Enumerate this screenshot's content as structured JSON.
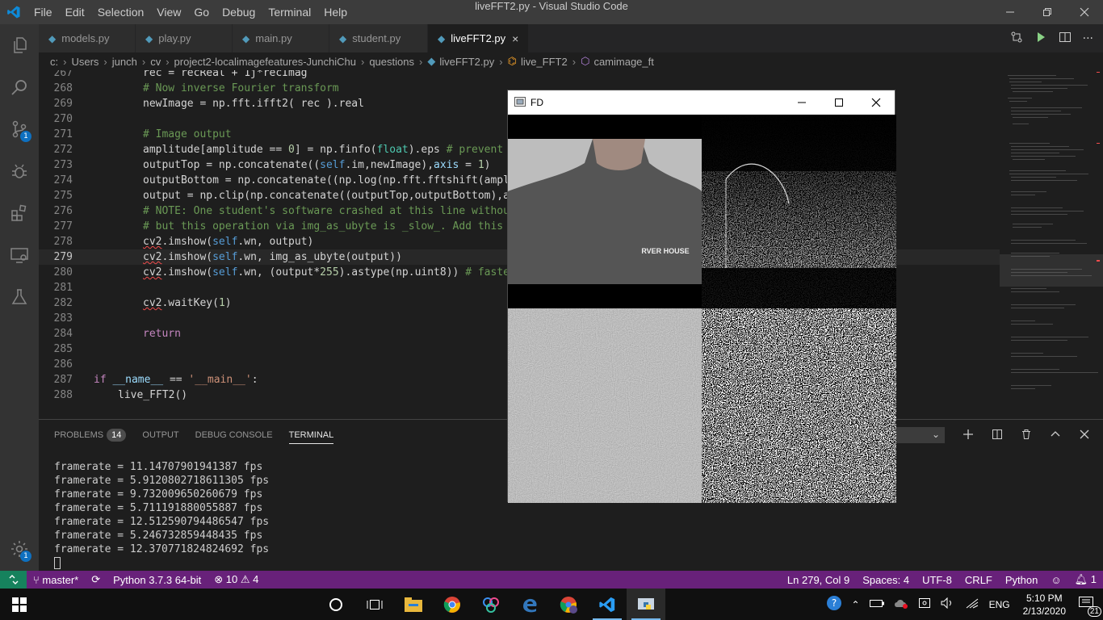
{
  "window": {
    "title": "liveFFT2.py - Visual Studio Code"
  },
  "menu": [
    "File",
    "Edit",
    "Selection",
    "View",
    "Go",
    "Debug",
    "Terminal",
    "Help"
  ],
  "activity_badges": {
    "source_control": "1",
    "settings": "1"
  },
  "tabs": [
    {
      "label": "models.py",
      "active": false
    },
    {
      "label": "play.py",
      "active": false
    },
    {
      "label": "main.py",
      "active": false
    },
    {
      "label": "student.py",
      "active": false
    },
    {
      "label": "liveFFT2.py",
      "active": true
    }
  ],
  "breadcrumb": [
    "c:",
    "Users",
    "junch",
    "cv",
    "project2-localimagefeatures-JunchiChu",
    "questions",
    "liveFFT2.py",
    "live_FFT2",
    "camimage_ft"
  ],
  "editor": {
    "line_numbers": [
      "267",
      "268",
      "269",
      "270",
      "271",
      "272",
      "273",
      "274",
      "275",
      "276",
      "277",
      "278",
      "279",
      "280",
      "281",
      "282",
      "283",
      "284",
      "285",
      "286",
      "287",
      "288"
    ],
    "code": {
      "l267a": "rec = recReal + 1j*recImag",
      "l268": "# Now inverse Fourier transform",
      "l269a": "newImage = np.fft.ifft2( rec ).real",
      "l271": "# Image output",
      "l272a": "amplitude[amplitude == ",
      "l272b": "0",
      "l272c": "] = np.finfo(",
      "l272d": "float",
      "l272e": ").eps ",
      "l272f": "# prevent a",
      "l273a": "outputTop = np.concatenate((",
      "l273b": "self",
      "l273c": ".im,newImage),",
      "l273d": "axis",
      "l273e": " = ",
      "l273f": "1",
      "l273g": ")",
      "l274a": "outputBottom = np.concatenate((np.log(np.fft.fftshift(ampli",
      "l275a": "output = np.clip(np.concatenate((outputTop,outputBottom),ax",
      "l276": "# NOTE: One student's software crashed at this line without",
      "l277": "# but this operation via img_as_ubyte is _slow_. Add this b",
      "l278a": "cv2",
      "l278b": ".imshow(",
      "l278c": "self",
      "l278d": ".wn, output)",
      "l279a": "cv2",
      "l279b": ".imshow(",
      "l279c": "self",
      "l279d": ".wn, img_as_ubyte(output))",
      "l280a": "cv2",
      "l280b": ".imshow(",
      "l280c": "self",
      "l280d": ".wn, (output*",
      "l280e": "255",
      "l280f": ").astype(np.uint8)) ",
      "l280g": "# faster",
      "l282a": "cv2",
      "l282b": ".waitKey(",
      "l282c": "1",
      "l282d": ")",
      "l284": "return",
      "l287a": "if",
      "l287b": " __name__ ",
      "l287c": "==",
      "l287d": " ",
      "l287e": "'__main__'",
      "l287f": ":",
      "l288a": "live_FFT2()"
    }
  },
  "panel": {
    "tabs": [
      "PROBLEMS",
      "OUTPUT",
      "DEBUG CONSOLE",
      "TERMINAL"
    ],
    "problems_count": "14",
    "terminal_lines": [
      "framerate = 11.14707901941387 fps",
      "framerate = 5.9120802718611305 fps",
      "framerate = 9.732009650260679 fps",
      "framerate = 5.711191880055887 fps",
      "framerate = 12.512590794486547 fps",
      "framerate = 5.246732859448435 fps",
      "framerate = 12.370771824824692 fps"
    ]
  },
  "statusbar": {
    "branch": "master*",
    "interpreter": "Python 3.7.3 64-bit",
    "errors": "10",
    "warnings": "4",
    "position": "Ln 279, Col 9",
    "spaces": "Spaces: 4",
    "encoding": "UTF-8",
    "eol": "CRLF",
    "language": "Python",
    "notifications": "1"
  },
  "fd_window": {
    "title": "FD",
    "shirt_text": "RVER HOUSE"
  },
  "taskbar": {
    "time": "5:10 PM",
    "date": "2/13/2020",
    "lang": "ENG",
    "notif_count": "21"
  },
  "colors": {
    "statusbar": "#68217a",
    "remote": "#16825d",
    "accent": "#0e70c0"
  }
}
